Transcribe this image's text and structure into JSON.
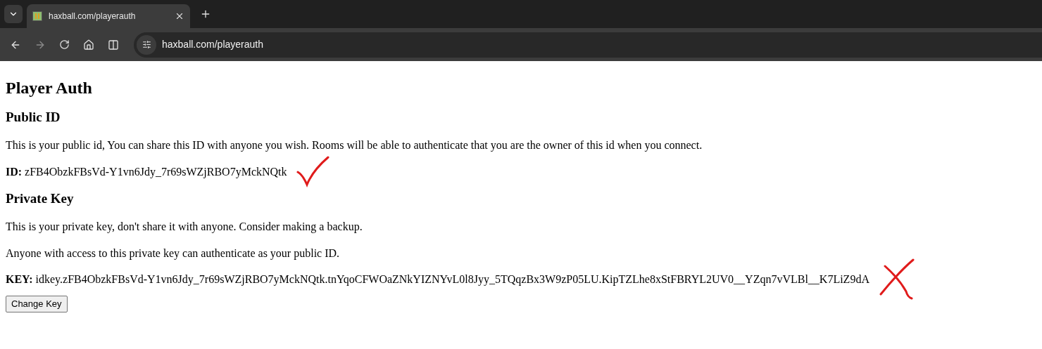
{
  "browser": {
    "tab": {
      "title": "haxball.com/playerauth",
      "selected": true
    },
    "address": "haxball.com/playerauth"
  },
  "page": {
    "title": "Player Auth",
    "sections": [
      {
        "heading": "Public ID",
        "paragraphs": [
          "This is your public id, You can share this ID with anyone you wish. Rooms will be able to authenticate that you are the owner of this id when you connect."
        ],
        "field": {
          "label": "ID:",
          "value": "zFB4ObzkFBsVd-Y1vn6Jdy_7r69sWZjRBO7yMckNQtk",
          "annotation": {
            "kind": "check"
          }
        }
      },
      {
        "heading": "Private Key",
        "paragraphs": [
          "This is your private key, don't share it with anyone. Consider making a backup.",
          "Anyone with access to this private key can authenticate as your public ID."
        ],
        "field": {
          "label": "KEY:",
          "value": "idkey.zFB4ObzkFBsVd-Y1vn6Jdy_7r69sWZjRBO7yMckNQtk.tnYqoCFWOaZNkYIZNYvL0l8Jyy_5TQqzBx3W9zP05LU.KipTZLhe8xStFBRYL2UV0__YZqn7vVLBl__K7LiZ9dA",
          "annotation": {
            "kind": "cross"
          }
        }
      }
    ],
    "button": "Change Key"
  }
}
